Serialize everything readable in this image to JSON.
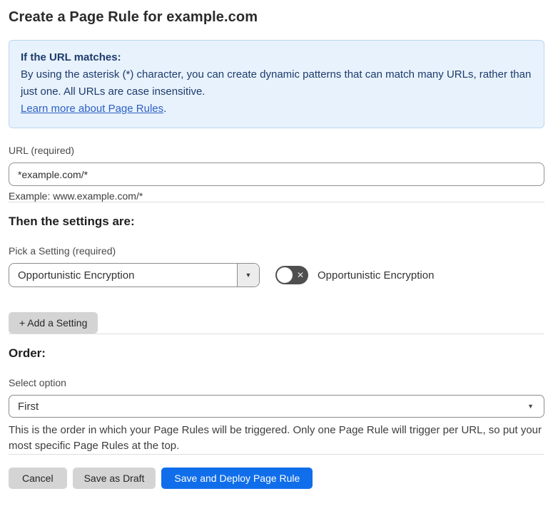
{
  "page": {
    "title": "Create a Page Rule for example.com"
  },
  "info_box": {
    "heading": "If the URL matches:",
    "body": "By using the asterisk (*) character, you can create dynamic patterns that can match many URLs, rather than just one. All URLs are case insensitive.",
    "link_label": "Learn more about Page Rules",
    "link_suffix": "."
  },
  "url_field": {
    "label": "URL (required)",
    "value": "*example.com/*",
    "helper": "Example: www.example.com/*"
  },
  "settings_section": {
    "heading": "Then the settings are:",
    "picker_label": "Pick a Setting (required)",
    "selected_setting": "Opportunistic Encryption",
    "toggle_state": "off",
    "toggle_label": "Opportunistic Encryption",
    "add_setting_button": "+ Add a Setting"
  },
  "order_section": {
    "heading": "Order:",
    "select_label": "Select option",
    "selected_option": "First",
    "helper": "This is the order in which your Page Rules will be triggered. Only one Page Rule will trigger per URL, so put your most specific Page Rules at the top."
  },
  "footer": {
    "cancel_label": "Cancel",
    "save_draft_label": "Save as Draft",
    "save_deploy_label": "Save and Deploy Page Rule"
  },
  "icons": {
    "caret_down": "▼",
    "toggle_off_x": "✕"
  },
  "colors": {
    "accent_blue": "#106eea",
    "info_background": "#e8f2fc",
    "info_border": "#b9d8f3",
    "info_text": "#1d3b6d",
    "link_blue": "#2d61c5",
    "toggle_off_background": "#4f4f4f",
    "gray_button_background": "#d4d4d4"
  }
}
